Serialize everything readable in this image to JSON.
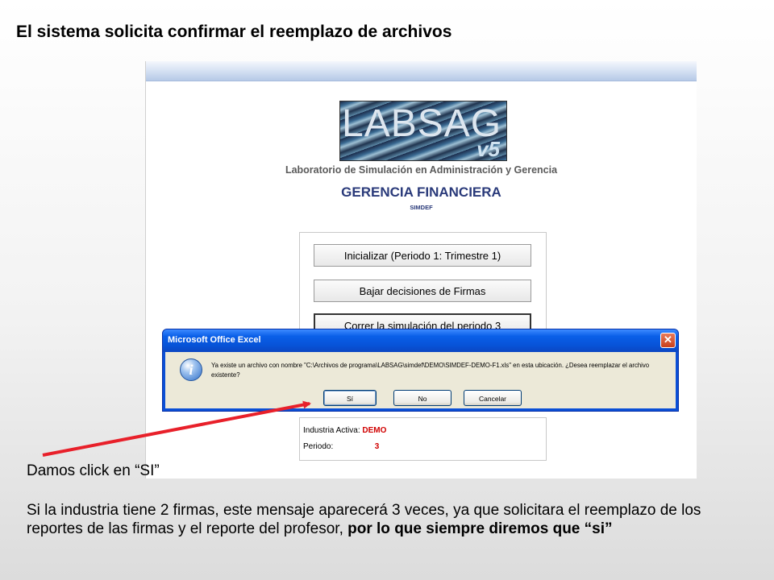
{
  "slide": {
    "title": "El sistema solicita confirmar el reemplazo de archivos",
    "caption_click": "Damos click en “SI”",
    "caption_body": "Si la industria tiene 2 firmas, este mensaje aparecerá 3 veces, ya que solicitara el reemplazo de los reportes de las firmas  y el reporte del profesor, ",
    "caption_emphasis": " por lo que siempre diremos que “si”"
  },
  "app": {
    "logo_text": "LABSAG",
    "logo_version": "v5",
    "subtitle": "Laboratorio de Simulación en Administración y Gerencia",
    "heading": "GERENCIA FINANCIERA",
    "code": "SIMDEF",
    "buttons": {
      "initialize": "Inicializar (Periodo 1: Trimestre 1)",
      "download": "Bajar decisiones de Firmas",
      "run": "Correr la simulación del periodo  3"
    },
    "info": {
      "industry_label": "Industria Activa:",
      "industry_value": "DEMO",
      "period_label": "Periodo:",
      "period_value": "3"
    }
  },
  "dialog": {
    "title": "Microsoft Office Excel",
    "close_glyph": "✕",
    "icon_glyph": "i",
    "message": "Ya existe un archivo con nombre \"C:\\Archivos de programa\\LABSAG\\simdef\\DEMO\\SIMDEF-DEMO-F1.xls\" en esta ubicación. ¿Desea reemplazar el archivo existente?",
    "buttons": {
      "yes": "Sí",
      "no": "No",
      "cancel": "Cancelar"
    }
  },
  "colors": {
    "arrow": "#e8202a",
    "dialog_title_bar": "#0a5fe8",
    "info_value": "#d00000",
    "heading": "#2a3a7a"
  }
}
